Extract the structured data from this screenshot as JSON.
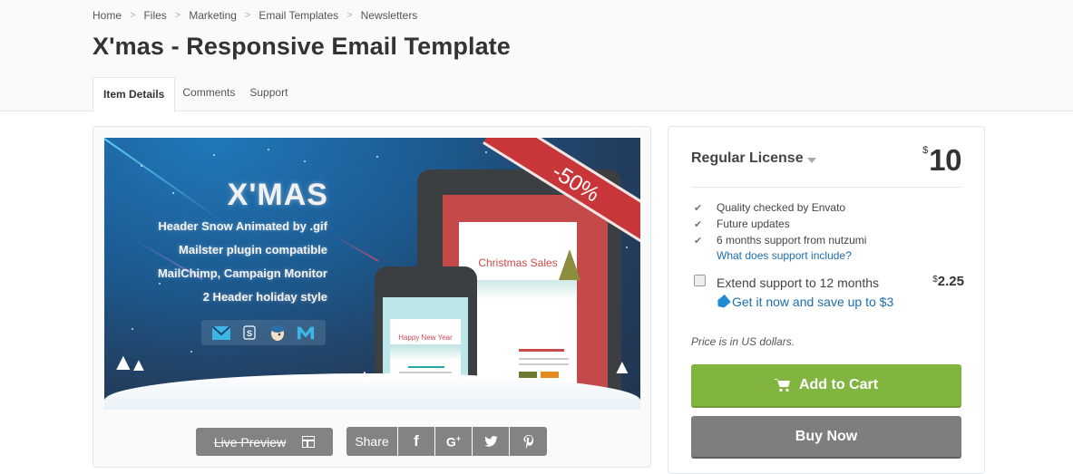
{
  "breadcrumb": [
    "Home",
    "Files",
    "Marketing",
    "Email Templates",
    "Newsletters"
  ],
  "breadcrumb_separator": ">",
  "page_title": "X'mas - Responsive Email Template",
  "tabs": [
    {
      "label": "Item Details",
      "active": true
    },
    {
      "label": "Comments",
      "active": false
    },
    {
      "label": "Support",
      "active": false
    }
  ],
  "preview": {
    "banner_title": "X'MAS",
    "features": [
      "Header Snow Animated by .gif",
      "Mailster plugin compatible",
      "MailChimp, Campaign Monitor",
      "2 Header holiday style"
    ],
    "compat_icons": [
      "mail-icon",
      "s-icon",
      "mailchimp-icon",
      "campaign-monitor-icon"
    ],
    "discount_label": "-50%",
    "tablet_email_title": "Christmas Sales",
    "phone_email_title": "Happy New Year",
    "live_preview_label": "Live Preview",
    "share_label": "Share",
    "share_buttons": [
      {
        "name": "facebook",
        "glyph": "f"
      },
      {
        "name": "google-plus",
        "glyph": "G+"
      },
      {
        "name": "twitter",
        "glyph": "🐦"
      },
      {
        "name": "pinterest",
        "glyph": "p"
      }
    ]
  },
  "purchase": {
    "license_label": "Regular License",
    "currency_symbol": "$",
    "price": "10",
    "features": [
      "Quality checked by Envato",
      "Future updates",
      "6 months support from nutzumi"
    ],
    "support_link": "What does support include?",
    "extend_label": "Extend support to 12 months",
    "extend_checked": false,
    "extend_price": "2.25",
    "save_link": "Get it now and save up to $3",
    "price_note": "Price is in US dollars.",
    "add_to_cart_label": "Add to Cart",
    "buy_now_label": "Buy Now"
  },
  "colors": {
    "accent_green": "#82b440",
    "link_blue": "#1c6eac",
    "button_gray": "#7e7e7e",
    "ribbon_red": "#c9363a"
  }
}
